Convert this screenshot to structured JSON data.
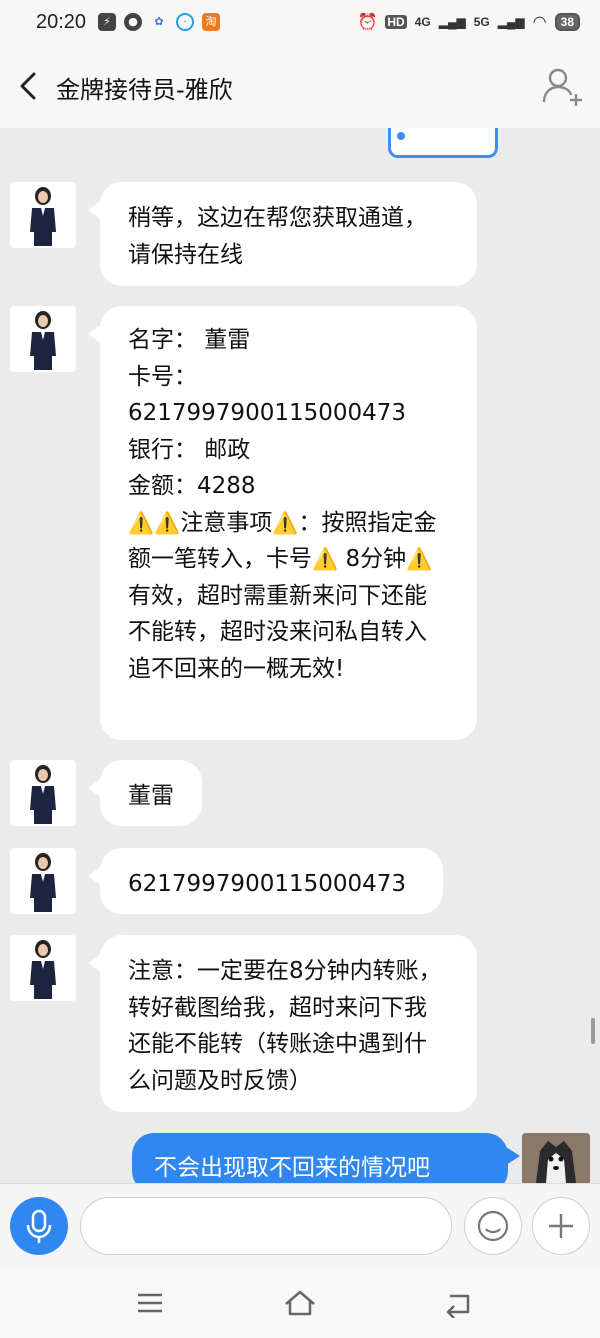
{
  "status_bar": {
    "time": "20:20",
    "notification_icons": [
      "flash-icon",
      "chat-icon",
      "paw-icon",
      "browser-icon",
      "taobao-icon"
    ],
    "taobao_label": "淘",
    "hd_label": "HD",
    "net1": "4G",
    "net2": "5G",
    "battery": "38"
  },
  "header": {
    "title": "金牌接待员-雅欣"
  },
  "messages": [
    {
      "from": "agent",
      "text": "稍等，这边在帮您获取通道，请保持在线"
    },
    {
      "from": "agent",
      "lines": [
        "名字：  董雷",
        "卡号：",
        "6217997900115000473",
        "银行：  邮政",
        "金额：4288"
      ],
      "notice_prefix": "注意事项",
      "notice_text_1": "：按照指定金额一笔转入，卡号",
      "notice_text_2": "8分钟",
      "notice_text_3": "有效，超时需重新来问下还能不能转，超时没来问私自转入追不回来的一概无效!",
      "warn_glyph": "⚠️"
    },
    {
      "from": "agent",
      "text": "董雷"
    },
    {
      "from": "agent",
      "text": "6217997900115000473"
    },
    {
      "from": "agent",
      "text": "注意：一定要在8分钟内转账，转好截图给我，超时来问下我还能不能转（转账途中遇到什么问题及时反馈）"
    },
    {
      "from": "me",
      "text": "不会出现取不回来的情况吧"
    }
  ],
  "colors": {
    "accent": "#2f87f0",
    "background": "#ebebeb",
    "bubble": "#ffffff"
  }
}
